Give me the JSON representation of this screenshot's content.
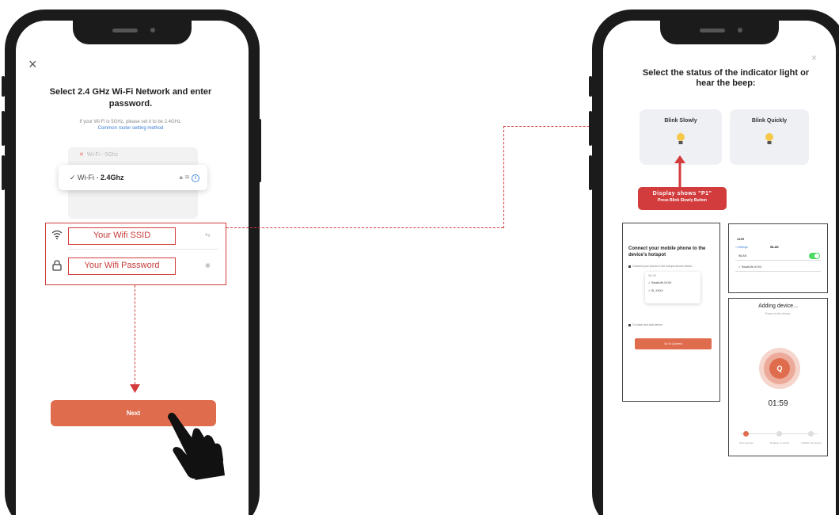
{
  "left_screen": {
    "close_glyph": "×",
    "title": "Select 2.4 GHz Wi-Fi Network and enter password.",
    "subtitle": "If your Wi-Fi is 5GHz, please set it to be 2.4GHz.",
    "link": "Common router setting method",
    "networks": {
      "blocked": "Wi-Fi - 5Ghz",
      "selected_prefix": "Wi-Fi - ",
      "selected_band": "2.4Ghz"
    },
    "fields": {
      "ssid": "Your Wifi SSID",
      "password": "Your Wifi Password"
    },
    "next_label": "Next"
  },
  "right_screen": {
    "close_glyph": "×",
    "title": "Select the status of the indicator light or hear the beep:",
    "blink_slowly": "Blink Slowly",
    "blink_quickly": "Blink Quickly",
    "badge": {
      "line1": "Display shows \"P1\"",
      "line2": "Press Blink Slowly Button"
    }
  },
  "hotspot_screen": {
    "title": "Connect your mobile phone to the device's hotspot",
    "step1": "Connect your phone to the hotspot shown below:",
    "list_header": "WLAN",
    "item1": "SmartLife-XXXX",
    "item2": "SL-XXXX",
    "step2": "Go back and add device.",
    "button": "Go to Connect"
  },
  "settings_screen": {
    "time": "14:09",
    "back": "< Settings",
    "heading": "WLAN",
    "row1": "WLAN",
    "row2": "SmartLife-XXXX"
  },
  "adding_screen": {
    "title": "Adding device...",
    "subtitle": "Power on the device.",
    "search_glyph": "Q",
    "timer": "01:59",
    "step_labels": [
      "Scan devices",
      "Register on Cloud",
      "Initialize the device"
    ]
  },
  "colors": {
    "accent": "#e06c4e",
    "callout_red": "#d33c3c",
    "phone_frame": "#1b1b1b"
  }
}
